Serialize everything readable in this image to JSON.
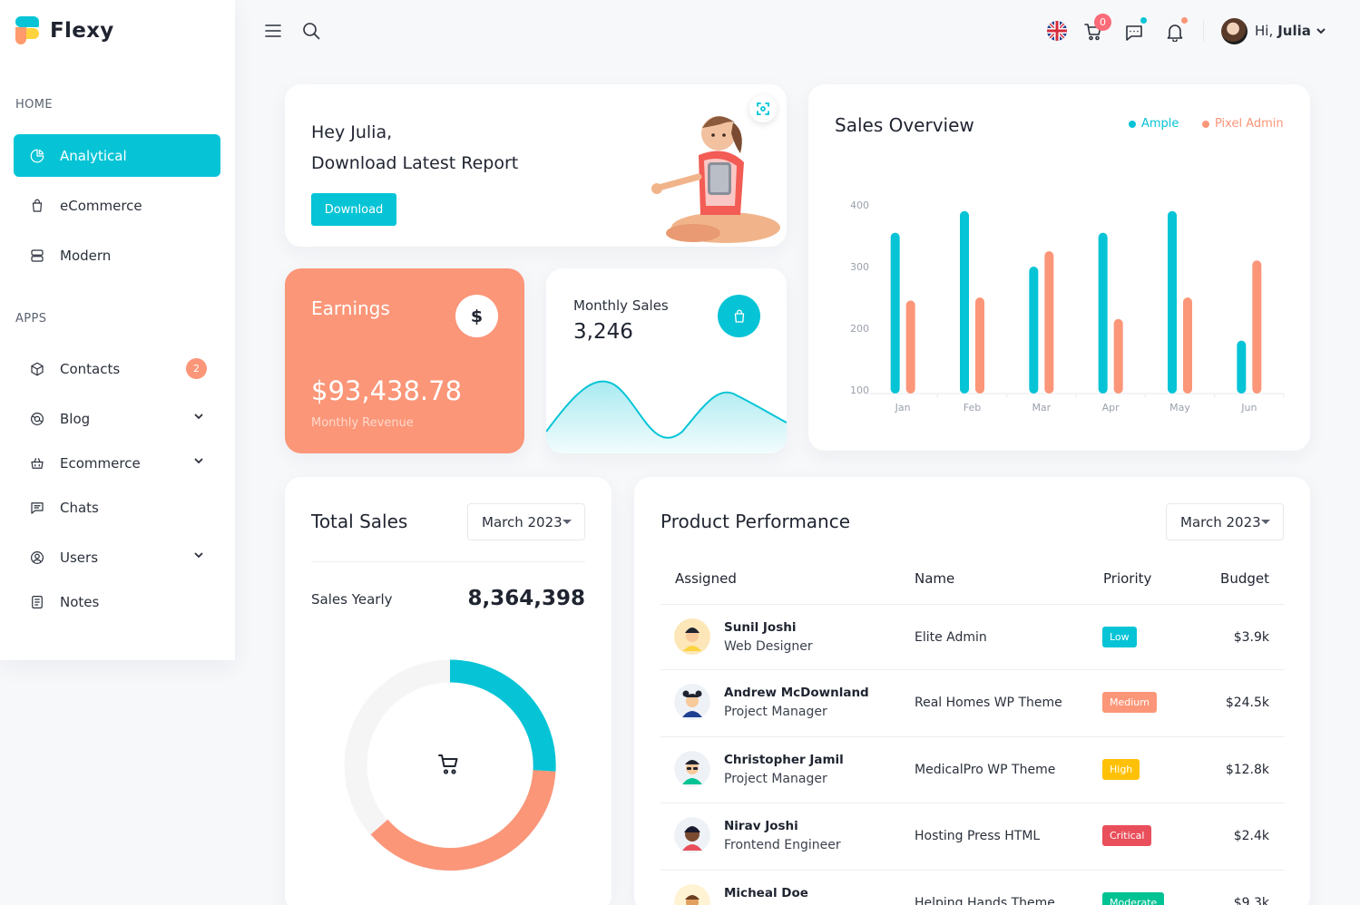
{
  "brand": {
    "name": "Flexy"
  },
  "sidebar": {
    "sections": [
      "HOME",
      "APPS"
    ],
    "home_items": [
      {
        "label": "Analytical",
        "icon": "pie-chart-icon",
        "active": true
      },
      {
        "label": "eCommerce",
        "icon": "shopping-bag-icon"
      },
      {
        "label": "Modern",
        "icon": "server-icon"
      }
    ],
    "app_items": [
      {
        "label": "Contacts",
        "icon": "box-icon",
        "badge": "2"
      },
      {
        "label": "Blog",
        "icon": "globe-icon",
        "expandable": true
      },
      {
        "label": "Ecommerce",
        "icon": "basket-icon",
        "expandable": true
      },
      {
        "label": "Chats",
        "icon": "message-icon"
      },
      {
        "label": "Users",
        "icon": "user-circle-icon",
        "expandable": true
      },
      {
        "label": "Notes",
        "icon": "notes-icon"
      }
    ]
  },
  "topbar": {
    "cart_count": "0",
    "greeting": "Hi,",
    "user_name": "Julia",
    "icons": [
      "menu-icon",
      "search-icon",
      "uk-flag-icon",
      "cart-icon",
      "chat-icon",
      "bell-icon",
      "chevron-down-icon"
    ]
  },
  "welcome": {
    "line1": "Hey Julia,",
    "line2": "Download Latest Report",
    "button": "Download"
  },
  "earnings": {
    "label": "Earnings",
    "value": "$93,438.78",
    "sub": "Monthly Revenue",
    "icon_text": "$"
  },
  "monthly_sales": {
    "label": "Monthly Sales",
    "value": "3,246"
  },
  "sales_overview": {
    "title": "Sales Overview",
    "colors": {
      "ample": "#06c4d6",
      "pixel": "#fb9678"
    },
    "chart_data": {
      "type": "bar",
      "title": "Sales Overview",
      "categories": [
        "Jan",
        "Feb",
        "Mar",
        "Apr",
        "May",
        "Jun"
      ],
      "series": [
        {
          "name": "Ample",
          "values": [
            355,
            390,
            300,
            355,
            390,
            180
          ]
        },
        {
          "name": "Pixel Admin",
          "values": [
            245,
            250,
            325,
            215,
            250,
            310
          ]
        }
      ],
      "yticks": [
        100,
        200,
        300,
        400
      ],
      "ylim": [
        100,
        400
      ],
      "legend": "top-right",
      "grid": false
    }
  },
  "total_sales": {
    "title": "Total Sales",
    "period": "March 2023",
    "label": "Sales Yearly",
    "value": "8,364,398"
  },
  "product_performance": {
    "title": "Product Performance",
    "period": "March 2023",
    "columns": [
      "Assigned",
      "Name",
      "Priority",
      "Budget"
    ],
    "rows": [
      {
        "name": "Sunil Joshi",
        "role": "Web Designer",
        "project": "Elite Admin",
        "priority": "Low",
        "priority_color": "#06c4d6",
        "budget": "$3.9k"
      },
      {
        "name": "Andrew McDownland",
        "role": "Project Manager",
        "project": "Real Homes WP Theme",
        "priority": "Medium",
        "priority_color": "#fb9678",
        "budget": "$24.5k"
      },
      {
        "name": "Christopher Jamil",
        "role": "Project Manager",
        "project": "MedicalPro WP Theme",
        "priority": "High",
        "priority_color": "#ffc107",
        "budget": "$12.8k"
      },
      {
        "name": "Nirav Joshi",
        "role": "Frontend Engineer",
        "project": "Hosting Press HTML",
        "priority": "Critical",
        "priority_color": "#e94f5b",
        "budget": "$2.4k"
      },
      {
        "name": "Micheal Doe",
        "role": "",
        "project": "Helping Hands Theme",
        "priority": "Moderate",
        "priority_color": "#00c292",
        "budget": "$9.3k"
      }
    ]
  }
}
